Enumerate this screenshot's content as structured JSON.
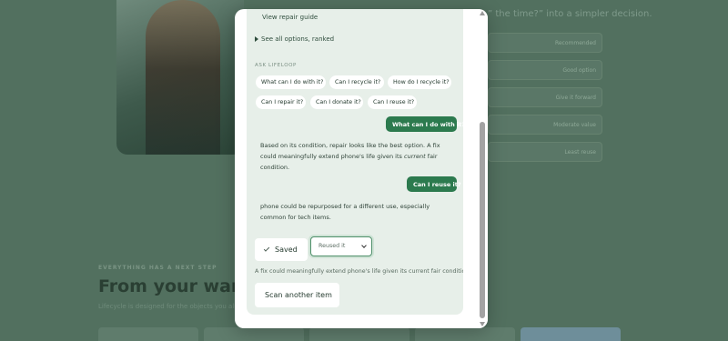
{
  "background": {
    "tagline": "” the time?” into a simpler decision.",
    "option_tags": [
      "Recommended",
      "Good option",
      "Give it forward",
      "Moderate value",
      "Least reuse"
    ],
    "eyebrow": "EVERYTHING HAS A NEXT STEP",
    "heading": "From your wardrobe",
    "subheading": "Lifecycle is designed for the objects you already own."
  },
  "modal": {
    "view_repair_guide": "View repair guide",
    "see_all_options": "See all options, ranked",
    "ask_label": "ASK LIFELOOP",
    "quick_questions": [
      "What can I do with it?",
      "Can I recycle it?",
      "How do I recycle it?",
      "Can I repair it?",
      "Can I donate it?",
      "Can I reuse it?"
    ],
    "messages": [
      {
        "role": "user",
        "text": "What can I do with it?"
      },
      {
        "role": "bot",
        "text_before": "Based on its condition, repair looks like the best option. A fix could meaningfully extend phone's life given its ",
        "text_em": "current",
        "text_after": " fair condition."
      },
      {
        "role": "user",
        "text": "Can I reuse it?"
      },
      {
        "role": "bot",
        "text": "phone could be repurposed for a different use, especially common for tech items."
      }
    ],
    "saved_label": "Saved",
    "outcome_select": {
      "value": "Reused it"
    },
    "summary": "A fix could meaningfully extend phone's life given its current fair condition.",
    "scan_button": "Scan another item"
  },
  "colors": {
    "overlay_bg": "#52705f",
    "panel_bg": "#e7efe9",
    "accent_green": "#2c7a4e"
  }
}
